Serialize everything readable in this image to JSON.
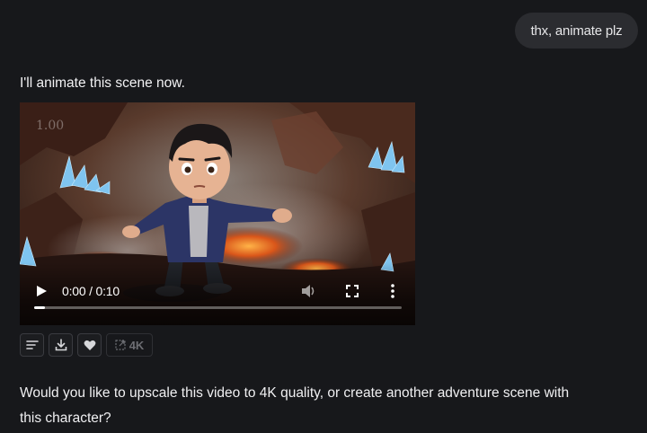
{
  "user_message": "thx, animate plz",
  "assistant": {
    "intro": "I'll animate this scene now.",
    "followup": "Would you like to upscale this video to 4K quality, or create another adventure scene with this character?"
  },
  "video": {
    "speed_watermark": "1.00",
    "time": "0:00 / 0:10",
    "progress": 0.03
  },
  "actions": {
    "upscale_label": "4K",
    "icons": [
      "details-icon",
      "download-icon",
      "heart-icon",
      "upscale-icon"
    ]
  }
}
